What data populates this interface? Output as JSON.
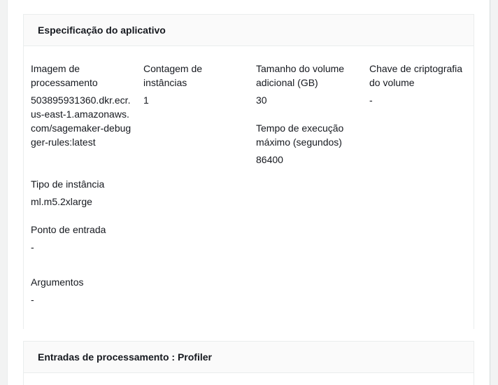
{
  "app_spec": {
    "title": "Especificação do aplicativo",
    "image_label": "Imagem de processamento",
    "image_value": "503895931360.dkr.ecr.us-east-1.amazonaws.com/sagemaker-debugger-rules:latest",
    "instance_type_label": "Tipo de instância",
    "instance_type_value": "ml.m5.2xlarge",
    "entrypoint_label": "Ponto de entrada",
    "entrypoint_value": "-",
    "arguments_label": "Argumentos",
    "arguments_value": "-",
    "instance_count_label": "Contagem de instâncias",
    "instance_count_value": "1",
    "volume_size_label": "Tamanho do volume adicional (GB)",
    "volume_size_value": "30",
    "max_runtime_label": "Tempo de execução máximo (segundos)",
    "max_runtime_value": "86400",
    "kms_key_label": "Chave de criptografia do volume",
    "kms_key_value": "-"
  },
  "processing_inputs": {
    "title": "Entradas de processamento : Profiler"
  }
}
